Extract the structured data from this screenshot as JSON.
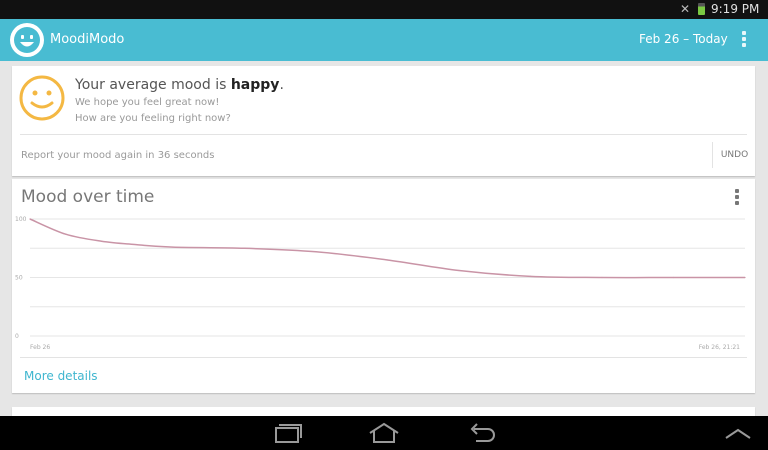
{
  "status_bar": {
    "time": "9:19 PM"
  },
  "app_bar": {
    "title": "MoodiModo",
    "date_range": "Feb 26 – Today"
  },
  "mood_card": {
    "headline_prefix": "Your average mood is ",
    "mood": "happy",
    "headline_suffix": ".",
    "sub1": "We hope you feel great now!",
    "sub2": "How are you feeling right now?",
    "report_text": "Report your mood again in 36 seconds",
    "undo_label": "UNDO"
  },
  "chart_card": {
    "title": "Mood over time",
    "more_details": "More details"
  },
  "colors": {
    "accent": "#49bcd2",
    "line": "#c994a6",
    "smiley": "#f4b843"
  },
  "chart_data": {
    "type": "line",
    "title": "Mood over time",
    "xlabel": "",
    "ylabel": "",
    "ylim": [
      0,
      100
    ],
    "yticks": [
      "100",
      "50",
      "0"
    ],
    "x_tick_labels": [
      "Feb 26",
      "Feb 26, 21:21"
    ],
    "x": [
      0,
      0.05,
      0.1,
      0.15,
      0.2,
      0.3,
      0.4,
      0.5,
      0.6,
      0.7,
      0.8,
      0.9,
      1.0
    ],
    "series": [
      {
        "values": [
          100,
          87,
          81,
          78,
          76,
          75,
          72,
          65,
          56,
          51,
          50,
          50,
          50
        ]
      }
    ],
    "grid": true
  }
}
